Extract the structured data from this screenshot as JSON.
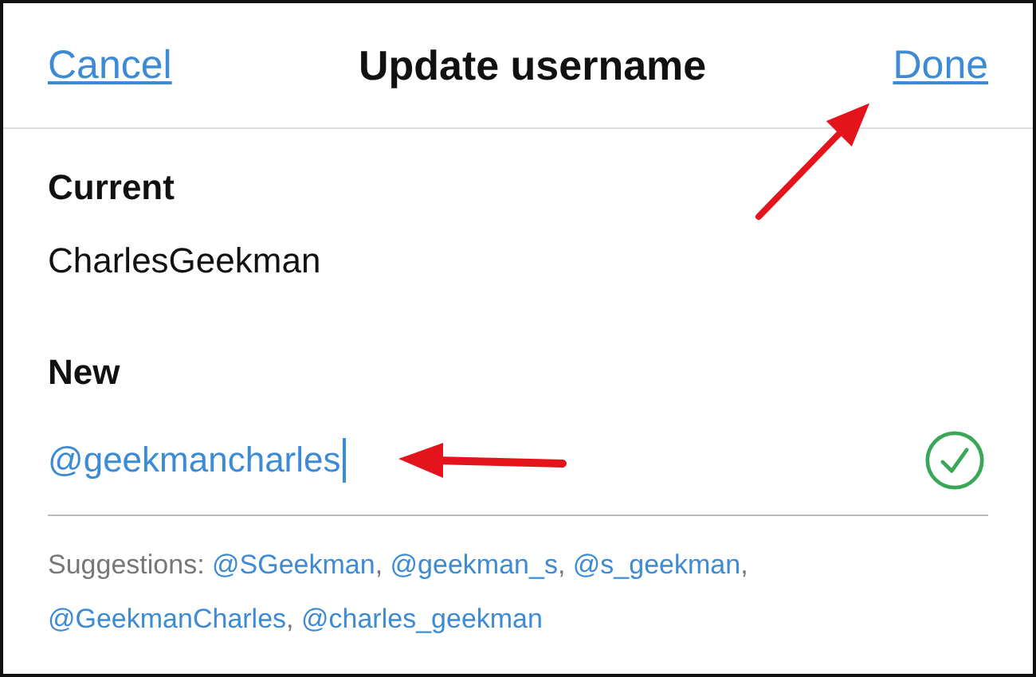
{
  "nav_bar": {
    "cancel": "Cancel",
    "title": "Update username",
    "done": "Done"
  },
  "current": {
    "label": "Current",
    "value": "CharlesGeekman"
  },
  "new": {
    "label": "New",
    "value": "@geekmancharles",
    "focused": true,
    "valid": true
  },
  "suggestions": {
    "label": "Suggestions:",
    "items": [
      {
        "text": "@SGeekman",
        "suffix": ","
      },
      {
        "text": "@geekman_s",
        "suffix": ","
      },
      {
        "text": "@s_geekman",
        "suffix": ","
      },
      {
        "text": "@GeekmanCharles",
        "suffix": ","
      },
      {
        "text": "@charles_geekman"
      }
    ]
  }
}
